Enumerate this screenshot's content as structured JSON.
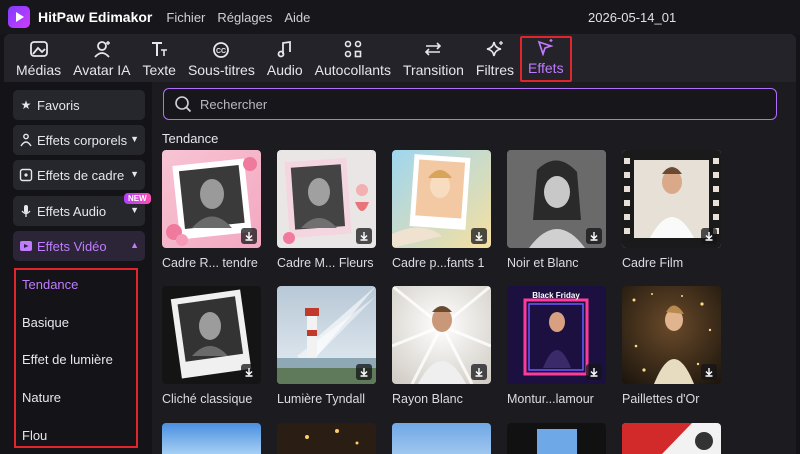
{
  "app": {
    "name": "HitPaw Edimakor",
    "menu": [
      "Fichier",
      "Réglages",
      "Aide"
    ],
    "project": "2026-05-14_01"
  },
  "toolbar": [
    {
      "label": "Médias",
      "icon": "media-icon"
    },
    {
      "label": "Avatar IA",
      "icon": "avatar-icon"
    },
    {
      "label": "Texte",
      "icon": "text-icon"
    },
    {
      "label": "Sous-titres",
      "icon": "subtitles-icon"
    },
    {
      "label": "Audio",
      "icon": "music-note-icon"
    },
    {
      "label": "Autocollants",
      "icon": "stickers-icon"
    },
    {
      "label": "Transition",
      "icon": "transition-icon"
    },
    {
      "label": "Filtres",
      "icon": "sparkle-icon"
    },
    {
      "label": "Effets",
      "icon": "magic-wand-icon",
      "active": true
    }
  ],
  "sidebar": {
    "items": [
      {
        "label": "Favoris",
        "icon": "star-icon"
      },
      {
        "label": "Effets corporels",
        "icon": "body-icon"
      },
      {
        "label": "Effets de cadre",
        "icon": "frame-icon"
      },
      {
        "label": "Effets Audio",
        "icon": "microphone-icon",
        "badge": "NEW"
      },
      {
        "label": "Effets Vidéo",
        "icon": "video-icon",
        "expanded": true
      }
    ],
    "subcategories": [
      "Tendance",
      "Basique",
      "Effet de lumière",
      "Nature",
      "Flou"
    ],
    "selected_subcategory": "Tendance"
  },
  "search": {
    "placeholder": "Rechercher"
  },
  "section_title": "Tendance",
  "effects_row1": [
    "Cadre R... tendre",
    "Cadre M... Fleurs",
    "Cadre p...fants 1",
    "Noir et Blanc",
    "Cadre Film"
  ],
  "effects_row2": [
    "Cliché classique",
    "Lumière Tyndall",
    "Rayon Blanc",
    "Montur...lamour",
    "Paillettes d'Or"
  ],
  "colors": {
    "accent": "#c07bff",
    "highlight_box": "#e0262c",
    "search_border": "#b46cff"
  }
}
